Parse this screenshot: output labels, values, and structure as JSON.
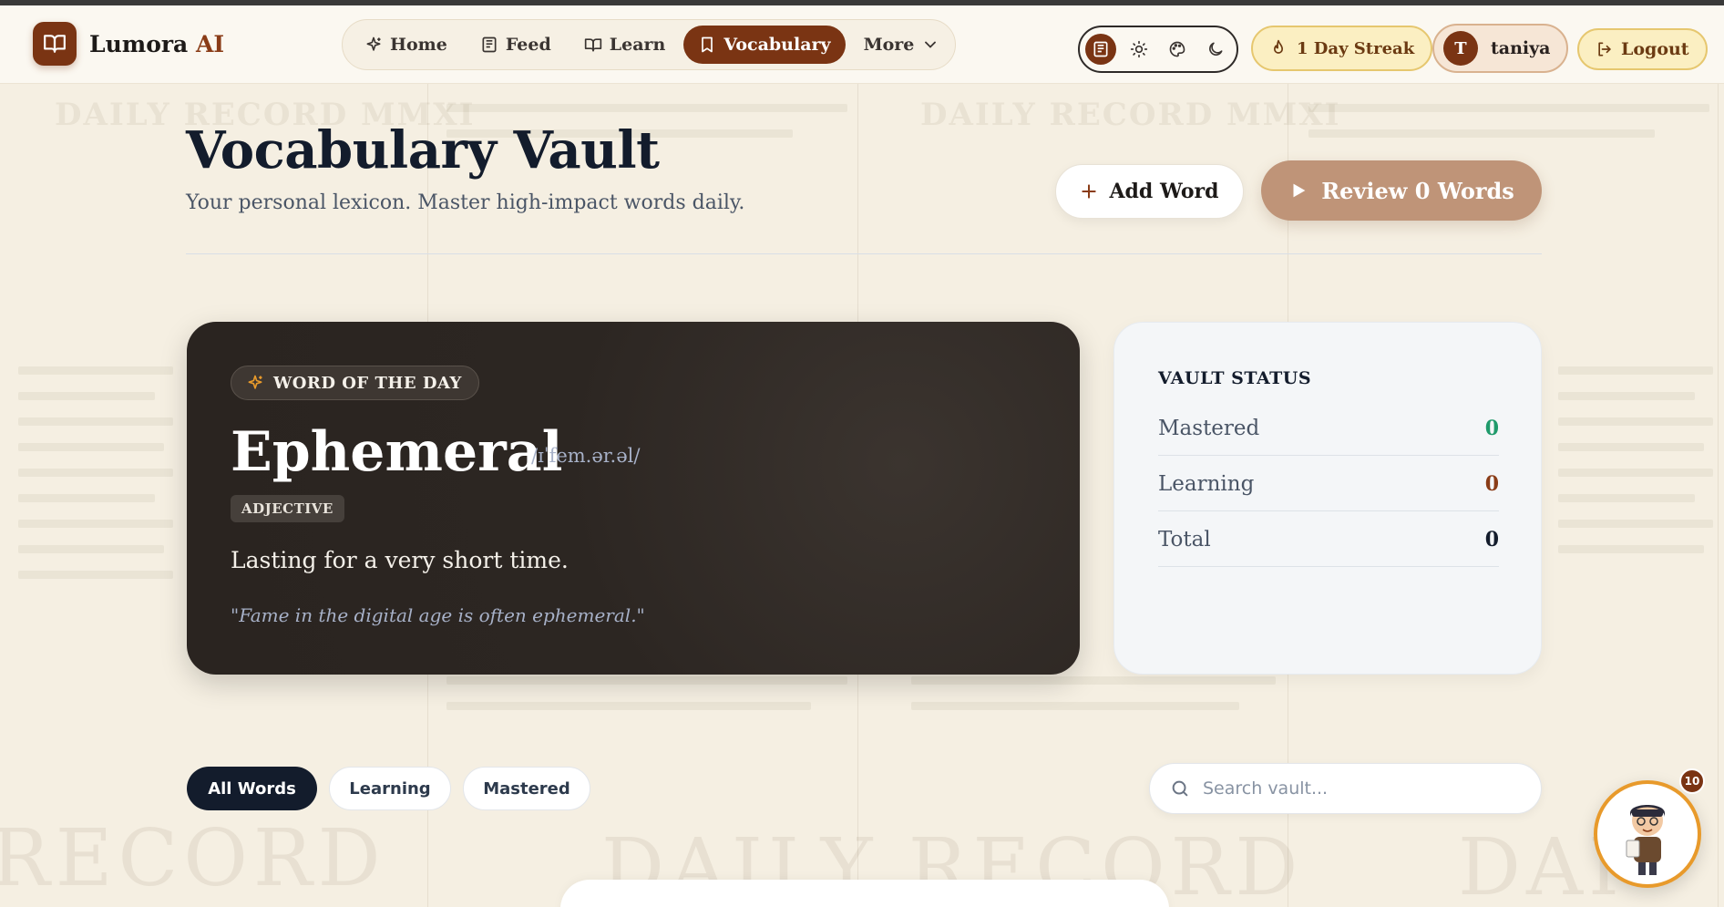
{
  "app": {
    "name": "Lumora",
    "name_accent": "AI"
  },
  "nav": {
    "items": [
      {
        "label": "Home",
        "icon": "sparkle-icon"
      },
      {
        "label": "Feed",
        "icon": "newspaper-icon"
      },
      {
        "label": "Learn",
        "icon": "book-open-icon"
      },
      {
        "label": "Vocabulary",
        "icon": "bookmark-icon",
        "active": true
      },
      {
        "label": "More",
        "icon": "chevron-down-icon"
      }
    ]
  },
  "theme_switch": [
    "newspaper-theme-icon",
    "sun-icon",
    "palette-icon",
    "moon-icon"
  ],
  "streak": {
    "label": "1 Day Streak"
  },
  "user": {
    "initial": "T",
    "name": "taniya"
  },
  "logout": {
    "label": "Logout"
  },
  "page": {
    "title": "Vocabulary Vault",
    "subtitle": "Your personal lexicon. Master high-impact words daily.",
    "add_word_label": "Add Word",
    "review_label": "Review 0 Words"
  },
  "word_of_day": {
    "badge": "WORD OF THE DAY",
    "word": "Ephemeral",
    "ipa": "/ɪˈfem.ər.əl/",
    "part_of_speech": "ADJECTIVE",
    "definition": "Lasting for a very short time.",
    "example": "\"Fame in the digital age is often ephemeral.\""
  },
  "vault_status": {
    "title": "VAULT STATUS",
    "rows": [
      {
        "label": "Mastered",
        "value": "0",
        "color": "#1f9a6b"
      },
      {
        "label": "Learning",
        "value": "0",
        "color": "#8a3c17"
      },
      {
        "label": "Total",
        "value": "0",
        "color": "#131c2c"
      }
    ]
  },
  "filters": {
    "all": "All Words",
    "learning": "Learning",
    "mastered": "Mastered"
  },
  "search": {
    "placeholder": "Search vault..."
  },
  "mascot": {
    "badge_count": "10"
  },
  "colors": {
    "brand": "#7a3413",
    "accent_gold": "#e89a2b",
    "dark_card": "#2c2622"
  }
}
